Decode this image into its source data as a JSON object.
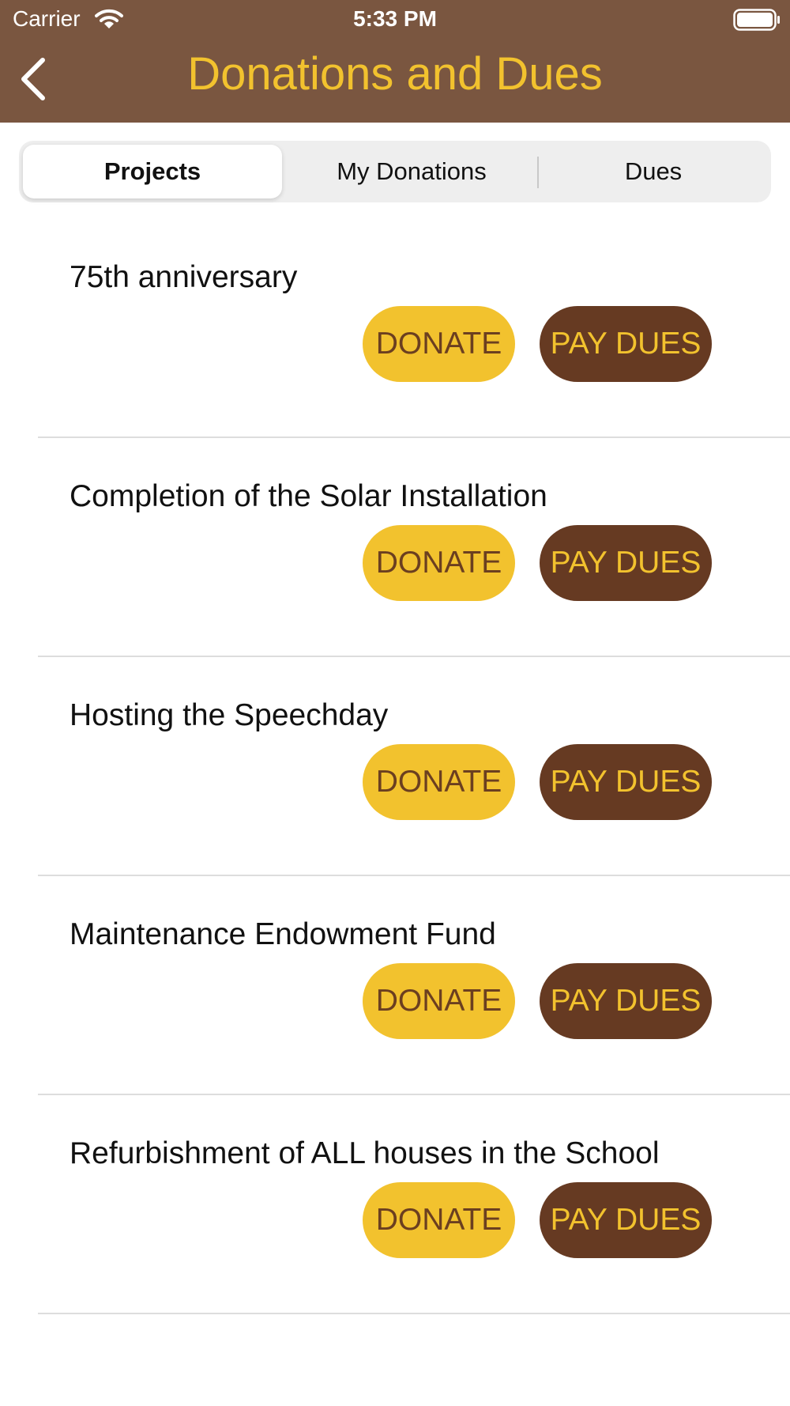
{
  "status_bar": {
    "carrier": "Carrier",
    "time": "5:33 PM"
  },
  "nav": {
    "title": "Donations and Dues"
  },
  "tabs": [
    {
      "label": "Projects",
      "selected": true
    },
    {
      "label": "My Donations",
      "selected": false
    },
    {
      "label": "Dues",
      "selected": false
    }
  ],
  "projects": [
    {
      "title": "75th anniversary",
      "donate_label": "DONATE",
      "pay_label": "PAY DUES"
    },
    {
      "title": "Completion of the Solar Installation",
      "donate_label": "DONATE",
      "pay_label": "PAY DUES"
    },
    {
      "title": "Hosting the Speechday",
      "donate_label": "DONATE",
      "pay_label": "PAY DUES"
    },
    {
      "title": "Maintenance Endowment Fund",
      "donate_label": "DONATE",
      "pay_label": "PAY DUES"
    },
    {
      "title": "Refurbishment of ALL houses in the School",
      "donate_label": "DONATE",
      "pay_label": "PAY DUES"
    }
  ],
  "colors": {
    "header_bg": "#7a5640",
    "accent_yellow": "#f2c22e",
    "dark_brown": "#663a22"
  },
  "icons": [
    "wifi-icon",
    "battery-icon",
    "chevron-left-icon"
  ]
}
